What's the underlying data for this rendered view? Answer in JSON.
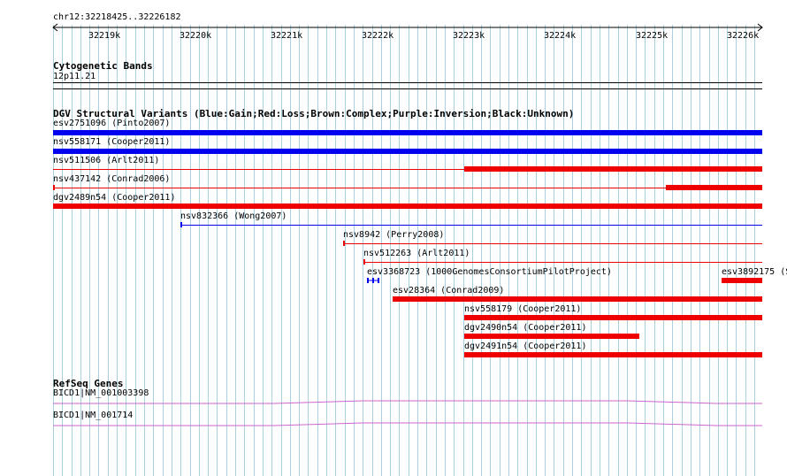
{
  "ruler": {
    "location": "chr12:32218425..32226182",
    "ticks": [
      "32219k",
      "32220k",
      "32221k",
      "32222k",
      "32223k",
      "32224k",
      "32225k",
      "32226k"
    ]
  },
  "cytoband": {
    "title": "Cytogenetic Bands",
    "band": "12p11.21"
  },
  "dgv": {
    "title": "DGV Structural Variants (Blue:Gain;Red:Loss;Brown:Complex;Purple:Inversion;Black:Unknown)",
    "features": [
      {
        "label": "esv2751096 (Pinto2007)"
      },
      {
        "label": "nsv558171 (Cooper2011)"
      },
      {
        "label": "nsv511506 (Arlt2011)"
      },
      {
        "label": "nsv437142 (Conrad2006)"
      },
      {
        "label": "dgv2489n54 (Cooper2011)"
      },
      {
        "label": "nsv832366 (Wong2007)"
      },
      {
        "label": "nsv8942 (Perry2008)"
      },
      {
        "label": "nsv512263 (Arlt2011)"
      },
      {
        "label": "esv3368723 (1000GenomesConsortiumPilotProject)"
      },
      {
        "label": "esv3892175 (S"
      },
      {
        "label": "esv28364 (Conrad2009)"
      },
      {
        "label": "nsv558179 (Cooper2011)"
      },
      {
        "label": "dgv2490n54 (Cooper2011)"
      },
      {
        "label": "dgv2491n54 (Cooper2011)"
      }
    ]
  },
  "refseq": {
    "title": "RefSeq Genes",
    "genes": [
      {
        "label": "BICD1|NM_001003398"
      },
      {
        "label": "BICD1|NM_001714"
      }
    ]
  },
  "colors": {
    "gain": "#0000ee",
    "loss": "#ee0000",
    "gene": "#cc66cc",
    "grid": "#a8d0e0"
  }
}
